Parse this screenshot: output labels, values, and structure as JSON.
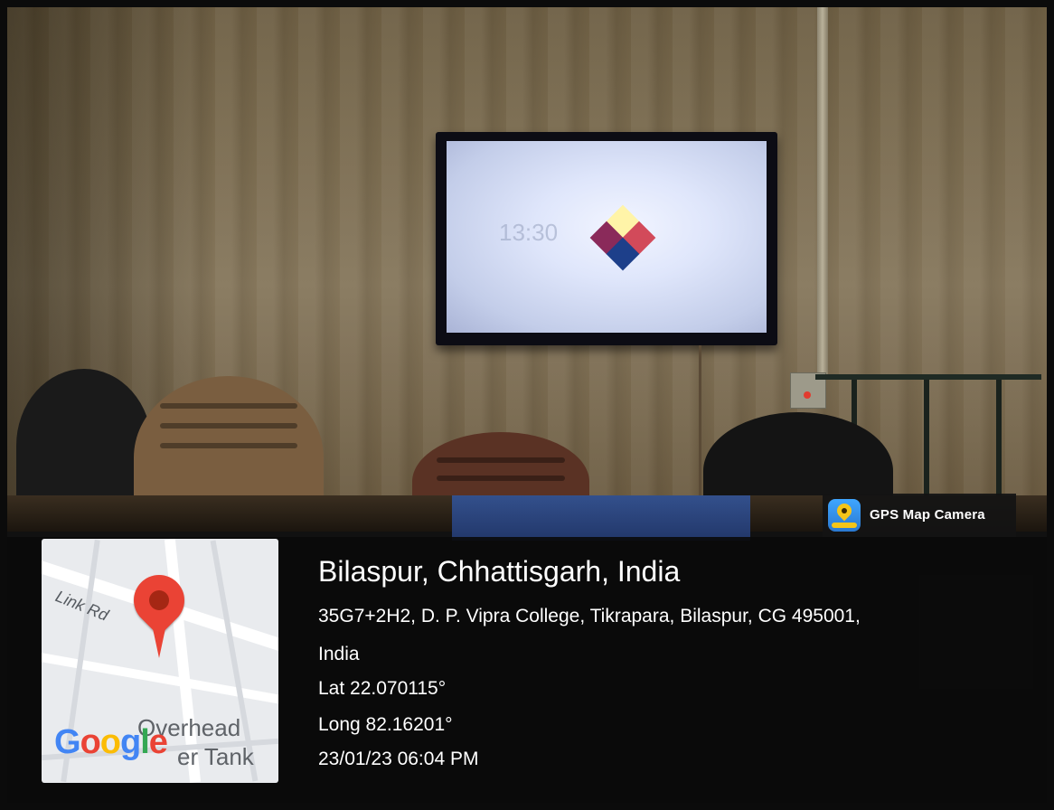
{
  "overlay": {
    "app_name": "GPS Map Camera",
    "app_icon": "gps-map-camera-icon",
    "location_title": "Bilaspur, Chhattisgarh, India",
    "address_line1": "35G7+2H2, D. P. Vipra College, Tikrapara, Bilaspur, CG 495001,",
    "address_line2": "India",
    "latitude": "Lat 22.070115°",
    "longitude": "Long 82.16201°",
    "datetime": "23/01/23 06:04 PM"
  },
  "map": {
    "road_label": "Link Rd",
    "landmark_line1": "Overhead",
    "landmark_line2": "er Tank",
    "logo": "Google",
    "marker_color": "#ea4335"
  },
  "scene": {
    "tv_clock": "13:30",
    "tile_colors": [
      "#fff4a8",
      "#8a2a5a",
      "#d24a5a",
      "#1d3f8a"
    ]
  }
}
